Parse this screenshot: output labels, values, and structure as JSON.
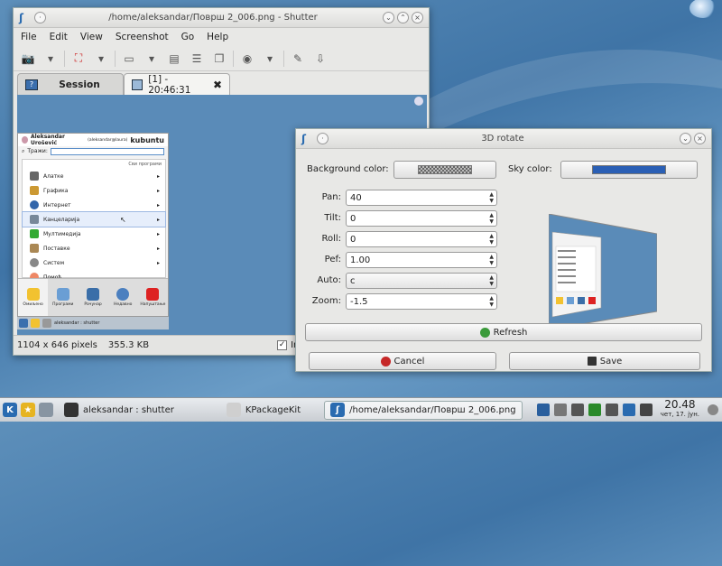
{
  "main_window": {
    "title": "/home/aleksandar/Површ 2_006.png - Shutter",
    "menu": [
      "File",
      "Edit",
      "View",
      "Screenshot",
      "Go",
      "Help"
    ],
    "tabs": [
      {
        "label": "Session"
      },
      {
        "label": "[1] - 20:46:31"
      }
    ],
    "status": {
      "dimensions": "1104 x 646 pixels",
      "size": "355.3 KB",
      "include_label": "Inclu"
    }
  },
  "kde_menu": {
    "user": "Aleksandar Urošević",
    "user_id": "(aleksandar@laura)",
    "brand": "kubuntu",
    "search_label": "Тражи:",
    "all_programs": "Сви програми",
    "items": [
      "Алатке",
      "Графика",
      "Интернет",
      "Канцеларија",
      "Мултимедија",
      "Поставке",
      "Систем",
      "Помоћ"
    ],
    "bottom_tabs": [
      "Омиљено",
      "Програми",
      "Рачунар",
      "Недавно",
      "Напуштање"
    ],
    "task_label": "aleksandar : shutter"
  },
  "rotate_dialog": {
    "title": "3D rotate",
    "background_color_label": "Background color:",
    "sky_color_label": "Sky color:",
    "sky_color": "#2a5fb5",
    "fields": [
      {
        "label": "Pan:",
        "value": "40"
      },
      {
        "label": "Tilt:",
        "value": "0"
      },
      {
        "label": "Roll:",
        "value": "0"
      },
      {
        "label": "Pef:",
        "value": "1.00"
      },
      {
        "label": "Auto:",
        "value": "c"
      },
      {
        "label": "Zoom:",
        "value": "-1.5"
      }
    ],
    "refresh_label": "Refresh",
    "cancel_label": "Cancel",
    "save_label": "Save"
  },
  "taskbar": {
    "tasks": [
      {
        "label": "aleksandar : shutter"
      },
      {
        "label": "KPackageKit"
      },
      {
        "label": "/home/aleksandar/Површ 2_006.png"
      }
    ],
    "clock_time": "20.48",
    "clock_date": "чет, 17. јун."
  }
}
